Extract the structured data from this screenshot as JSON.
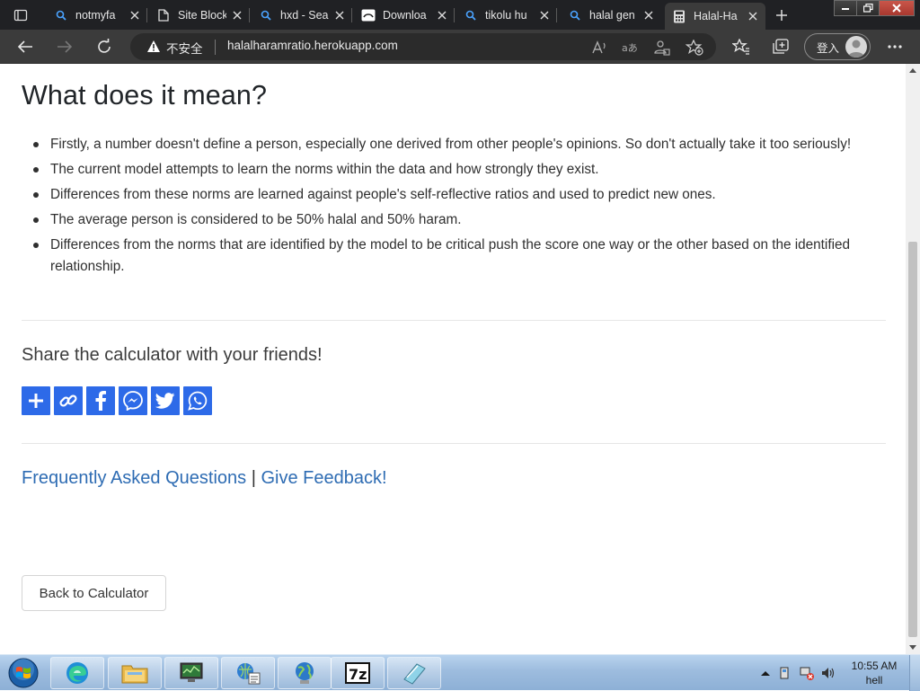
{
  "browser": {
    "tabs": [
      {
        "title": "notmyfa",
        "icon": "search-icon"
      },
      {
        "title": "Site Block",
        "icon": "page-icon"
      },
      {
        "title": "hxd - Sea",
        "icon": "search-icon"
      },
      {
        "title": "Downloa",
        "icon": "download-site-icon"
      },
      {
        "title": "tikolu hu",
        "icon": "search-icon"
      },
      {
        "title": "halal gen",
        "icon": "search-icon"
      },
      {
        "title": "Halal-Ha",
        "icon": "calculator-icon",
        "active": true
      }
    ],
    "address": {
      "security_label": "不安全",
      "url": "halalharamratio.herokuapp.com"
    },
    "signin_label": "登入"
  },
  "page": {
    "heading": "What does it mean?",
    "points": [
      "Firstly, a number doesn't define a person, especially one derived from other people's opinions. So don't actually take it too seriously!",
      "The current model attempts to learn the norms within the data and how strongly they exist.",
      "Differences from these norms are learned against people's self-reflective ratios and used to predict new ones.",
      "The average person is considered to be 50% halal and 50% haram.",
      "Differences from the norms that are identified by the model to be critical push the score one way or the other based on the identified relationship."
    ],
    "share_title": "Share the calculator with your friends!",
    "share_buttons": [
      "add-share-icon",
      "copy-link-icon",
      "facebook-icon",
      "messenger-icon",
      "twitter-icon",
      "whatsapp-icon"
    ],
    "links": {
      "faq": "Frequently Asked Questions",
      "separator": "|",
      "feedback": "Give Feedback!"
    },
    "back_button": "Back to Calculator",
    "accent_color": "#2d6ae8",
    "link_color": "#2e6cb3"
  },
  "taskbar": {
    "clock_time": "10:55 AM",
    "clock_user": "hell",
    "pinned": [
      "edge-icon",
      "explorer-icon",
      "monitor-app-icon",
      "network-app-icon",
      "globe-app-icon",
      "7zip-icon",
      "notepad-icon"
    ]
  }
}
